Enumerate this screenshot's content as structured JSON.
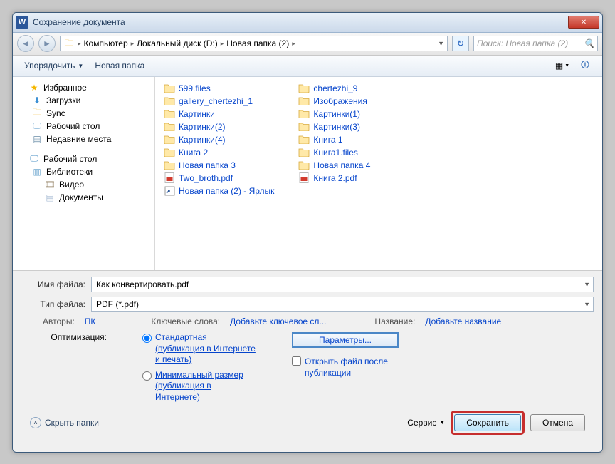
{
  "window": {
    "title": "Сохранение документа",
    "wordIcon": "W"
  },
  "breadcrumb": {
    "segments": [
      "Компьютер",
      "Локальный диск (D:)",
      "Новая папка (2)"
    ],
    "searchPlaceholder": "Поиск: Новая папка (2)"
  },
  "toolbar": {
    "organize": "Упорядочить",
    "newFolder": "Новая папка"
  },
  "sidebar": {
    "favorites": {
      "label": "Избранное",
      "items": [
        "Загрузки",
        "Sync",
        "Рабочий стол",
        "Недавние места"
      ]
    },
    "desktop": {
      "label": "Рабочий стол"
    },
    "libraries": {
      "label": "Библиотеки",
      "items": [
        "Видео",
        "Документы"
      ]
    }
  },
  "files": {
    "col1": [
      {
        "name": "599.files",
        "type": "folder"
      },
      {
        "name": "gallery_chertezhi_1",
        "type": "folder"
      },
      {
        "name": "Картинки",
        "type": "folder"
      },
      {
        "name": "Картинки(2)",
        "type": "folder"
      },
      {
        "name": "Картинки(4)",
        "type": "folder"
      },
      {
        "name": "Книга 2",
        "type": "folder"
      },
      {
        "name": "Новая папка 3",
        "type": "folder"
      },
      {
        "name": "Two_broth.pdf",
        "type": "pdf"
      },
      {
        "name": "Новая папка (2) - Ярлык",
        "type": "shortcut"
      }
    ],
    "col2": [
      {
        "name": "chertezhi_9",
        "type": "folder"
      },
      {
        "name": "Изображения",
        "type": "folder"
      },
      {
        "name": "Картинки(1)",
        "type": "folder"
      },
      {
        "name": "Картинки(3)",
        "type": "folder"
      },
      {
        "name": "Книга 1",
        "type": "folder"
      },
      {
        "name": "Книга1.files",
        "type": "folder"
      },
      {
        "name": "Новая папка 4",
        "type": "folder"
      },
      {
        "name": "Книга 2.pdf",
        "type": "pdf"
      }
    ]
  },
  "form": {
    "fileNameLabel": "Имя файла:",
    "fileName": "Как конвертировать.pdf",
    "fileTypeLabel": "Тип файла:",
    "fileType": "PDF (*.pdf)",
    "authorsLbl": "Авторы:",
    "authors": "ПК",
    "keywordsLbl": "Ключевые слова:",
    "keywords": "Добавьте ключевое сл...",
    "titleLbl": "Название:",
    "titleVal": "Добавьте название",
    "optimizeLbl": "Оптимизация:",
    "optStd": "Стандартная (публикация в Интернете и печать)",
    "optMin": "Минимальный размер (публикация в Интернете)",
    "paramsBtn": "Параметры...",
    "openAfter": "Открыть файл после публикации"
  },
  "footer": {
    "hideFolders": "Скрыть папки",
    "service": "Сервис",
    "save": "Сохранить",
    "cancel": "Отмена"
  }
}
